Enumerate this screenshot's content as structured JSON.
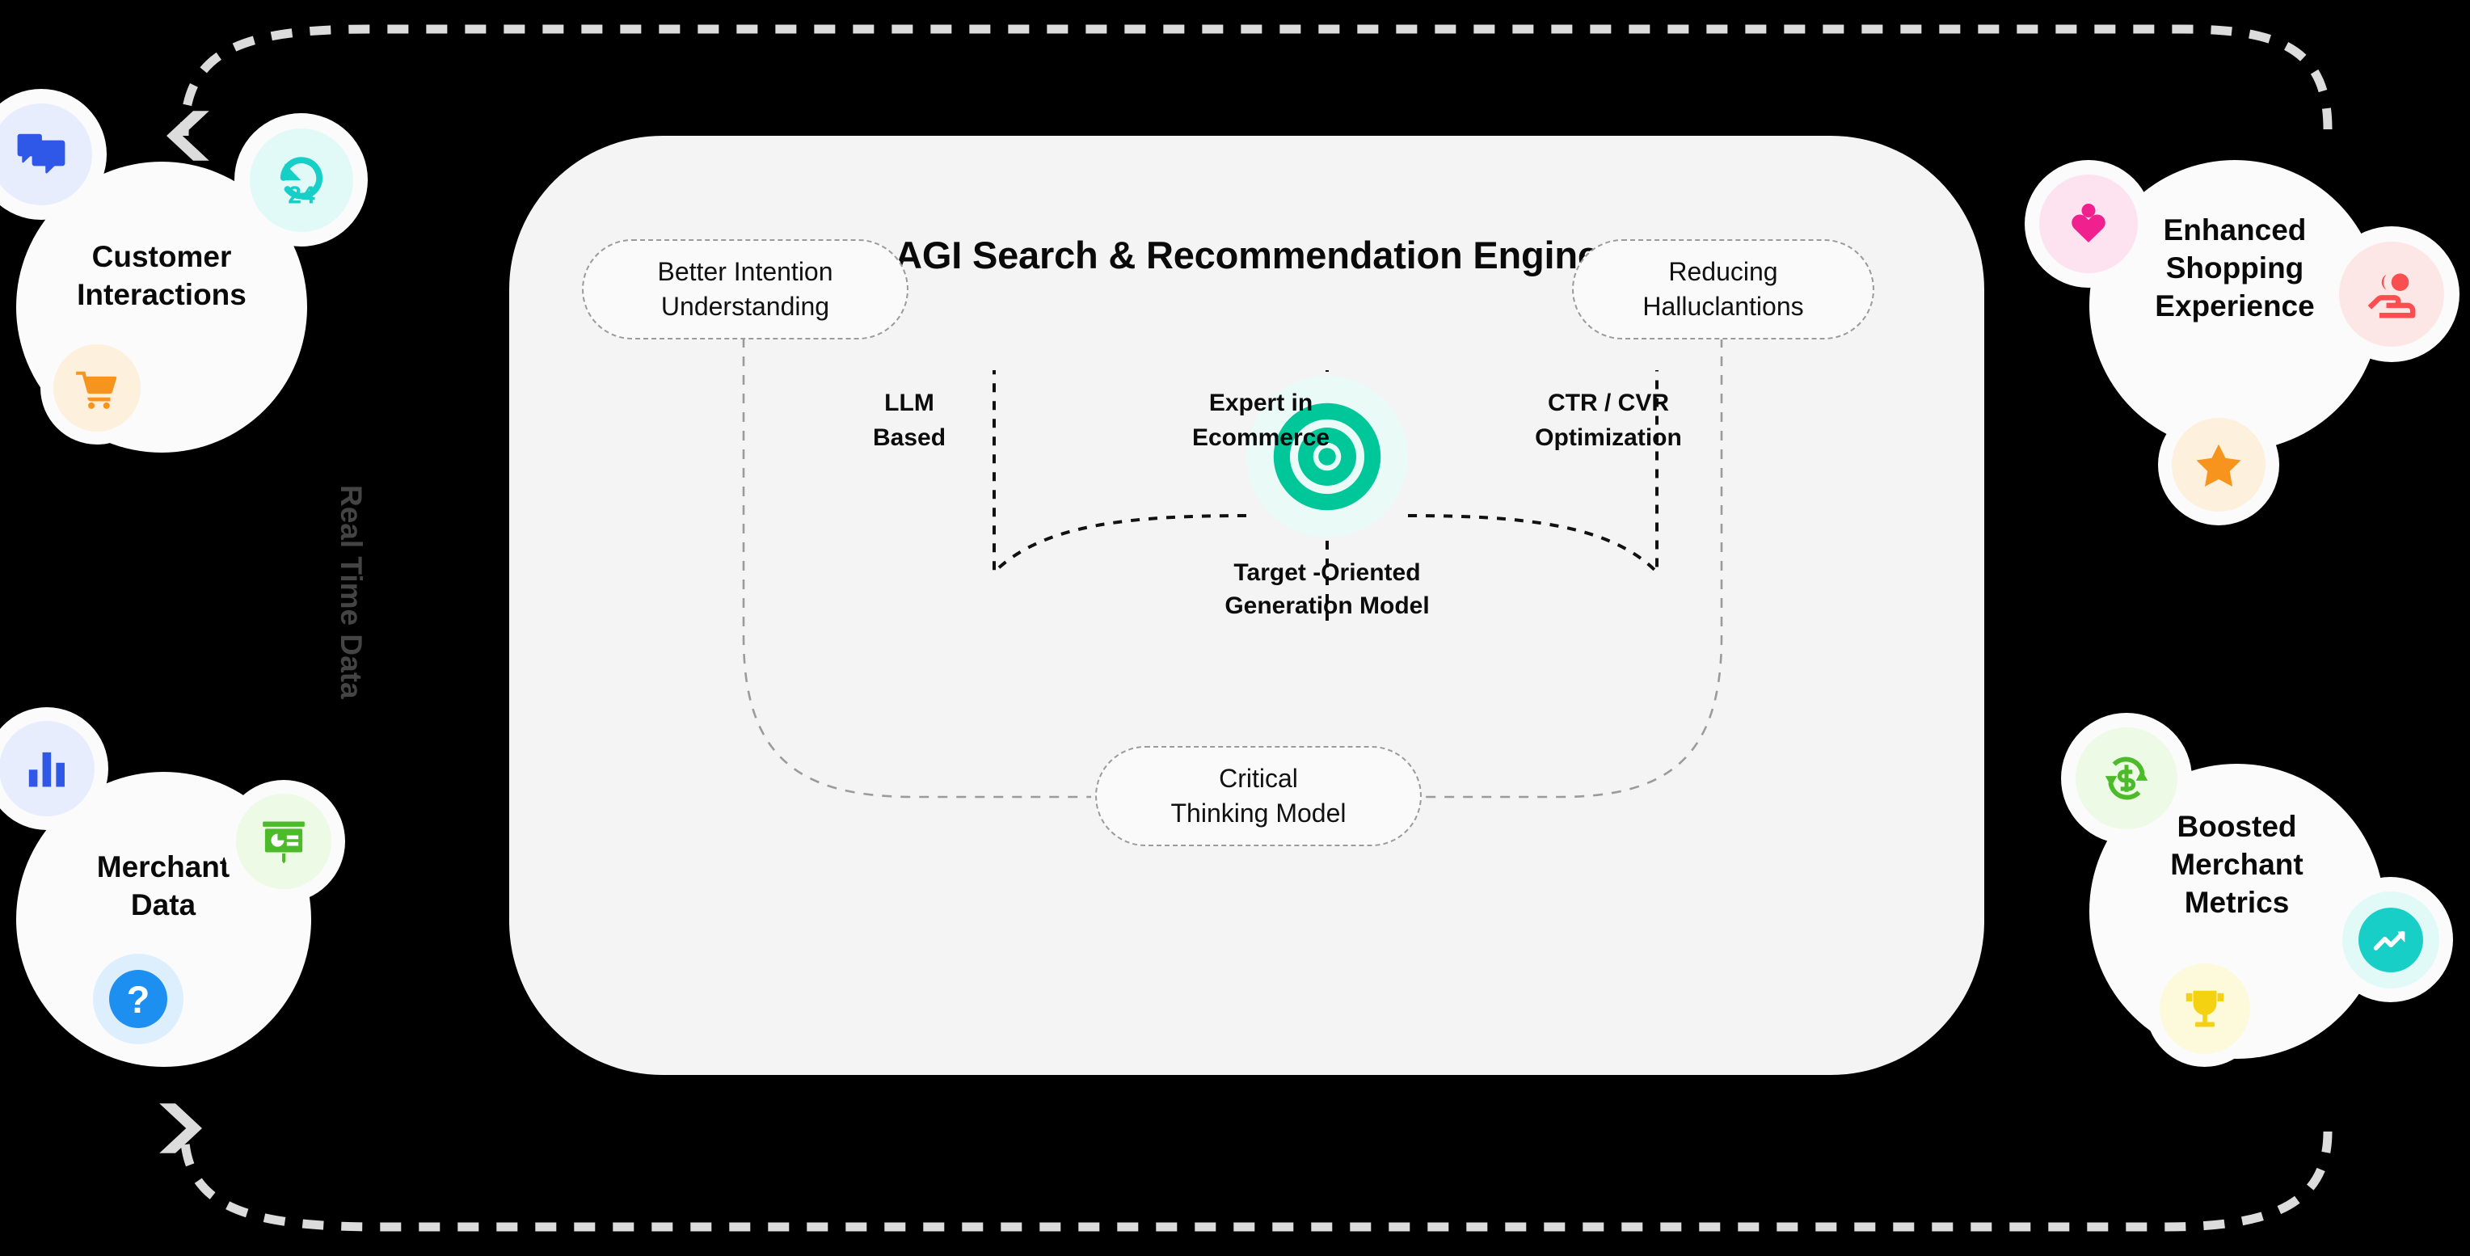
{
  "engine": {
    "title": "AGI Search & Recommendation Engine",
    "core": {
      "icon": "target-crosshair-icon",
      "label_line1": "Target -Oriented",
      "label_line2": "Generation Model",
      "accent": "#00c79a",
      "halo": "#eafaf6"
    },
    "pills": [
      {
        "id": "better-intention",
        "line1": "Better Intention",
        "line2": "Understanding"
      },
      {
        "id": "reducing-hallucinations",
        "line1": "Reducing",
        "line2": "Halluclantions"
      },
      {
        "id": "critical-thinking",
        "line1": "Critical",
        "line2": "Thinking Model"
      }
    ],
    "leaves": [
      {
        "id": "llm-based",
        "line1": "LLM",
        "line2": "Based"
      },
      {
        "id": "expert-ecommerce",
        "line1": "Expert in",
        "line2": "Ecommerce"
      },
      {
        "id": "ctr-cvr",
        "line1": "CTR / CVR",
        "line2": "Optimization"
      }
    ],
    "panel_bg": "#f4f4f4"
  },
  "loop_caption": "Real Time Data",
  "clusters": [
    {
      "id": "customer-interactions",
      "line1": "Customer",
      "line2": "Interactions",
      "chips": [
        {
          "icon": "chat-bubbles-icon",
          "color": "#2f57e8",
          "bg": "#e8edfd"
        },
        {
          "icon": "24h-support-icon",
          "color": "#18cfc8",
          "bg": "#e1faf8"
        },
        {
          "icon": "shopping-cart-icon",
          "color": "#f7941d",
          "bg": "#fdf0dc"
        }
      ]
    },
    {
      "id": "merchant-data",
      "line1": "Merchant",
      "line2": "Data",
      "chips": [
        {
          "icon": "bar-chart-icon",
          "color": "#2f57e8",
          "bg": "#e8edfd"
        },
        {
          "icon": "presentation-board-icon",
          "color": "#4cbb2a",
          "bg": "#edfae6"
        },
        {
          "icon": "question-mark-icon",
          "color": "#1d8ff0",
          "bg": "#ddeffd"
        }
      ]
    },
    {
      "id": "enhanced-shopping-experience",
      "line1": "Enhanced",
      "line2": "Shopping",
      "line3": "Experience",
      "chips": [
        {
          "icon": "person-heart-icon",
          "color": "#f0218e",
          "bg": "#fde3f0"
        },
        {
          "icon": "customer-service-hand-icon",
          "color": "#fb4e50",
          "bg": "#fde7e6"
        },
        {
          "icon": "star-icon",
          "color": "#f7941d",
          "bg": "#fdf0dc"
        }
      ]
    },
    {
      "id": "boosted-merchant-metrics",
      "line1": "Boosted",
      "line2": "Merchant",
      "line3": "Metrics",
      "chips": [
        {
          "icon": "money-refresh-icon",
          "color": "#4cbb2a",
          "bg": "#edfae6"
        },
        {
          "icon": "trend-up-icon",
          "color": "#18cfc8",
          "bg": "#e1faf8"
        },
        {
          "icon": "trophy-icon",
          "color": "#f5d211",
          "bg": "#fdfadc"
        }
      ]
    }
  ],
  "colors": {
    "dashed_loop": "#dcdcdc",
    "dashed_inner": "#9b9b9b",
    "dashed_core": "#111111",
    "canvas": "#000000"
  }
}
